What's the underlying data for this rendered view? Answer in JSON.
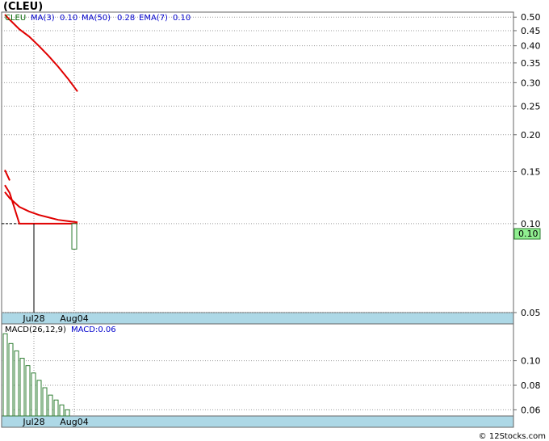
{
  "chart_data": [
    {
      "type": "line",
      "title": "(CLEU)",
      "scale": "log",
      "ylim": [
        0.05,
        0.52
      ],
      "y_ticks": [
        "0.50",
        "0.45",
        "0.40",
        "0.35",
        "0.30",
        "0.25",
        "0.20",
        "0.15",
        "0.10",
        "0.05"
      ],
      "x_ticks": [
        "Jul28",
        "Aug04"
      ],
      "legend": [
        {
          "label": "CLEU",
          "color": "#006400"
        },
        {
          "label": "MA(3)",
          "value": "0.10",
          "color": "#0000cc"
        },
        {
          "label": "MA(50)",
          "value": "0.28",
          "color": "#0000cc"
        },
        {
          "label": "EMA(7)",
          "value": "0.10",
          "color": "#0000cc"
        }
      ],
      "last_price_label": "0.10",
      "candles": [
        {
          "x": "Jul28",
          "open": 0.1,
          "close": 0.1,
          "high": 0.1,
          "low": 0.05
        },
        {
          "x": "Aug04",
          "open": 0.1,
          "close": 0.082,
          "high": 0.1,
          "low": 0.082
        }
      ],
      "series": [
        {
          "name": "MA(50)",
          "color": "#e00000",
          "points": [
            [
              0,
              0.51
            ],
            [
              0.5,
              0.49
            ],
            [
              1.5,
              0.455
            ],
            [
              2.5,
              0.43
            ],
            [
              3.5,
              0.4
            ],
            [
              4.5,
              0.37
            ],
            [
              5.5,
              0.34
            ],
            [
              6.5,
              0.31
            ],
            [
              7.5,
              0.28
            ]
          ]
        },
        {
          "name": "MA(3)",
          "color": "#e00000",
          "points": [
            [
              0,
              0.135
            ],
            [
              0.5,
              0.127
            ],
            [
              1.5,
              0.1
            ],
            [
              3.5,
              0.1
            ],
            [
              5.5,
              0.1
            ],
            [
              7.5,
              0.1
            ]
          ]
        },
        {
          "name": "EMA(7)",
          "color": "#e00000",
          "points": [
            [
              0,
              0.128
            ],
            [
              0.5,
              0.122
            ],
            [
              1.5,
              0.114
            ],
            [
              2.5,
              0.11
            ],
            [
              3.5,
              0.107
            ],
            [
              4.5,
              0.105
            ],
            [
              5.5,
              0.103
            ],
            [
              6.5,
              0.102
            ],
            [
              7.5,
              0.101
            ]
          ]
        },
        {
          "name": "",
          "color": "#e00000",
          "points": [
            [
              0,
              0.152
            ],
            [
              0.5,
              0.14
            ]
          ]
        }
      ]
    },
    {
      "type": "bar",
      "title": "MACD(26,12,9)",
      "annotation": "MACD:0.06",
      "ylim": [
        0.055,
        0.13
      ],
      "y_ticks": [
        "0.10",
        "0.08",
        "0.06"
      ],
      "x_ticks": [
        "Jul28",
        "Aug04"
      ],
      "values": [
        0.122,
        0.114,
        0.108,
        0.102,
        0.096,
        0.09,
        0.084,
        0.078,
        0.072,
        0.068,
        0.064,
        0.06
      ]
    }
  ],
  "watermark": "© 12Stocks.com"
}
